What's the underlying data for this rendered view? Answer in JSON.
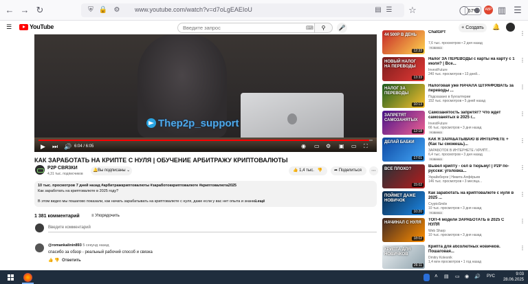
{
  "browser": {
    "url": "www.youtube.com/watch?v=d7oLgEAEIoU",
    "zoom": "67%"
  },
  "masthead": {
    "logo_text": "YouTube",
    "search_placeholder": "Введите запрос",
    "create_label": "Создать"
  },
  "video": {
    "watermark": "Thep2p_support",
    "time": "6:04 / 6:05",
    "progress_fraction": 0.99,
    "title": "КАК ЗАРАБОТАТЬ НА КРИПТЕ С НУЛЯ | ОБУЧЕНИЕ АРБИТРАЖУ КРИПТОВАЛЮТЫ"
  },
  "owner": {
    "channel": "P2P СВЯЗКИ",
    "subs": "4,31 тыс. подписчиков",
    "subscribed_label": "Вы подписаны",
    "likes": "1,4 тыс.",
    "share_label": "Поделиться"
  },
  "description": {
    "meta": "10 тыс. просмотров  7 дней назад  #арбитражкриптовалюты #заработоккриптовалюте #криптовалюта2025",
    "line1": "Как заработать на криптовалюте в 2025 году?",
    "line2": "В этом видео мы пошагово показали, как начать зарабатывать на криптовалюте с нуля, даже если у вас нет опыта и знаний.",
    "more": "...ещё"
  },
  "comments": {
    "count": "1 381 комментарий",
    "sort_label": "Упорядочить",
    "add_placeholder": "Введите комментарий",
    "first": {
      "author": "@romankalinin893",
      "time": "5 секунд назад",
      "text": "спасибо за обзор - реальный рабочий способ и связка",
      "reply_label": "Ответить"
    }
  },
  "sidebar": [
    {
      "title": "ChatGPT",
      "channel": "",
      "meta": "7,6 тыс. просмотров • 2 дня назад",
      "badge": "Новинка",
      "dur": "12:33",
      "thumb_text": "44 500Р В ДЕНЬ",
      "c1": "#c62828",
      "c2": "#ffd54f"
    },
    {
      "title": "Налог ЗА ПЕРЕВОДЫ с карты на карту с 1 июля? | Все...",
      "channel": "InvestFuture",
      "meta": "240 тыс. просмотров • 13 дней...",
      "badge": "",
      "dur": "13:33",
      "thumb_text": "НОВЫЙ НАЛОГ НА ПЕРЕВОДЫ",
      "c1": "#7a1d1d",
      "c2": "#e53935"
    },
    {
      "title": "Налоговая уже НАЧАЛА ШТРАФОВАТЬ за переводы ...",
      "channel": "Подсказано в бухгалтерии",
      "meta": "152 тыс. просмотров • 5 дней назад",
      "badge": "",
      "dur": "10:13",
      "thumb_text": "НАЛОГ ЗА ПЕРЕВОДЫ",
      "c1": "#1b5e20",
      "c2": "#fbc02d"
    },
    {
      "title": "Самозанятость запретят? Что ждет самозанятых в 2025 г...",
      "channel": "InvestFuture",
      "meta": "66 тыс. просмотров • 3 дня назад",
      "badge": "Новинка",
      "dur": "12:18",
      "thumb_text": "ЗАПРЕТЯТ САМОЗАНЯТЫХ",
      "c1": "#4a148c",
      "c2": "#f06292"
    },
    {
      "title": "КАК Я ЗАРАБАТЫВАЮ В ИНТЕРНЕТЕ + (Как ты сможешь)...",
      "channel": "ЗАРАБОТОК В ИНТЕРНЕТЕ / КРИПТ...",
      "meta": "6,4 тыс. просмотров • 3 дня назад",
      "badge": "Новинка",
      "dur": "17:01",
      "thumb_text": "ДЕЛАЙ БАБКИ",
      "c1": "#0d47a1",
      "c2": "#42a5f5"
    },
    {
      "title": "Вывел крипту - сел в тюрьму! | P2P по-русски: уголовка...",
      "channel": "Украйнберги | Никита Алфёрьев",
      "meta": "146 тыс. просмотров • 3 месяца...",
      "badge": "",
      "dur": "15:02",
      "thumb_text": "ВСЕ ПЛОХО?",
      "c1": "#263238",
      "c2": "#b71c1c"
    },
    {
      "title": "Как заработать на криптовалюте с нуля в 2025 ...",
      "channel": "CryptoSmile",
      "meta": "10 тыс. просмотров • 3 дня назад",
      "badge": "Новинка",
      "dur": "10:20",
      "thumb_text": "ПОЙМЕТ ДАЖЕ НОВИЧОК",
      "c1": "#0b2a4a",
      "c2": "#1e88e5"
    },
    {
      "title": "ТОП-4 модели ЗАРАБОТАТЬ в 2025 С НУЛЯ",
      "channel": "Web Sharp",
      "meta": "10 тыс. просмотров • 3 дня назад",
      "badge": "",
      "dur": "18:02",
      "thumb_text": "НАЧИНАЛ С НУЛЯ",
      "c1": "#3e2723",
      "c2": "#ff8f00"
    },
    {
      "title": "Крипта для абсолютных новичков. Пошаговая...",
      "channel": "Dmitry Kolesnik",
      "meta": "1,4 млн просмотров • 1 год назад",
      "badge": "",
      "dur": "26:11",
      "thumb_text": "КРИПТА ДЛЯ НОВИЧКОВ",
      "c1": "#eceff1",
      "c2": "#90a4ae"
    }
  ],
  "taskbar": {
    "lang": "РУС",
    "time": "9:03",
    "date": "28.06.2025"
  }
}
